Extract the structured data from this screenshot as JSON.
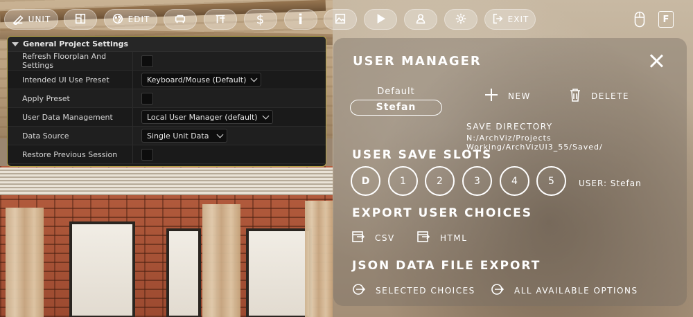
{
  "toolbar": {
    "buttons": [
      {
        "label": "UNIT",
        "icon": "pencil-ruler-icon"
      },
      {
        "label": "",
        "icon": "floorplan-icon"
      },
      {
        "label": "EDIT",
        "icon": "palette-icon"
      },
      {
        "label": "",
        "icon": "sofa-icon"
      },
      {
        "label": "",
        "icon": "stairs-icon"
      },
      {
        "label": "$",
        "icon": "dollar-icon"
      },
      {
        "label": "i",
        "icon": "info-icon"
      },
      {
        "label": "",
        "icon": "image-icon"
      },
      {
        "label": "",
        "icon": "play-icon"
      },
      {
        "label": "",
        "icon": "user-icon"
      },
      {
        "label": "",
        "icon": "gear-icon"
      },
      {
        "label": "EXIT",
        "icon": "exit-icon"
      }
    ],
    "right_key": "F",
    "right_icon": "mouse-icon"
  },
  "settings_panel": {
    "title": "General Project Settings",
    "rows": [
      {
        "label": "Refresh Floorplan And Settings",
        "type": "checkbox",
        "value": ""
      },
      {
        "label": "Intended UI Use Preset",
        "type": "dropdown",
        "value": "Keyboard/Mouse (Default)"
      },
      {
        "label": "Apply Preset",
        "type": "checkbox",
        "value": ""
      },
      {
        "label": "User Data Management",
        "type": "dropdown",
        "value": "Local User Manager (default)"
      },
      {
        "label": "Data Source",
        "type": "dropdown",
        "value": "Single Unit Data"
      },
      {
        "label": "Restore Previous Session",
        "type": "checkbox",
        "value": ""
      }
    ]
  },
  "user_manager": {
    "title": "USER MANAGER",
    "default_label": "Default",
    "current_user": "Stefan",
    "new_label": "NEW",
    "delete_label": "DELETE",
    "save_directory_label": "SAVE DIRECTORY",
    "save_directory": "N:/ArchViz/Projects Working/ArchVizUI3_55/Saved/",
    "save_slots_heading": "USER SAVE SLOTS",
    "slots": [
      "D",
      "1",
      "2",
      "3",
      "4",
      "5"
    ],
    "user_label": "USER: Stefan",
    "export_heading": "EXPORT USER CHOICES",
    "export_csv": "CSV",
    "export_html": "HTML",
    "json_heading": "JSON DATA FILE EXPORT",
    "json_selected": "SELECTED CHOICES",
    "json_all": "ALL AVAILABLE OPTIONS"
  }
}
